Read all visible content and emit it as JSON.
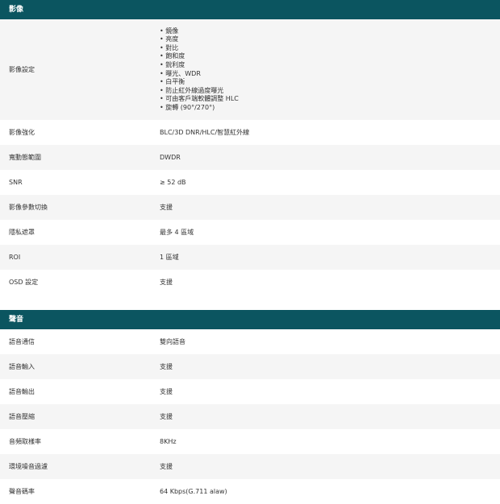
{
  "video": {
    "title": "影像",
    "settings_label": "影像設定",
    "settings_items": [
      "鏡像",
      "亮度",
      "對比",
      "飽和度",
      "銳利度",
      "曝光、WDR",
      "白平衡",
      "防止紅外線過度曝光",
      "可由客戶端軟體調整 HLC",
      "旋轉 (90°/270°)"
    ],
    "rows": [
      {
        "label": "影像強化",
        "value": "BLC/3D DNR/HLC/智慧紅外線"
      },
      {
        "label": "寬動態範圍",
        "value": "DWDR"
      },
      {
        "label": "SNR",
        "value": "≥ 52 dB"
      },
      {
        "label": "影像參數切換",
        "value": "支援"
      },
      {
        "label": "隱私遮罩",
        "value": "最多 4 區域"
      },
      {
        "label": "ROI",
        "value": "1 區域"
      },
      {
        "label": "OSD 設定",
        "value": "支援"
      }
    ]
  },
  "audio": {
    "title": "聲音",
    "rows": [
      {
        "label": "語音通信",
        "value": "雙向語音"
      },
      {
        "label": "語音輸入",
        "value": "支援"
      },
      {
        "label": "語音輸出",
        "value": "支援"
      },
      {
        "label": "語音壓縮",
        "value": "支援"
      },
      {
        "label": "音頻取樣率",
        "value": "8KHz"
      },
      {
        "label": "環境噪音過濾",
        "value": "支援"
      },
      {
        "label": "聲音碼率",
        "value": "64 Kbps(G.711 alaw)"
      }
    ]
  }
}
